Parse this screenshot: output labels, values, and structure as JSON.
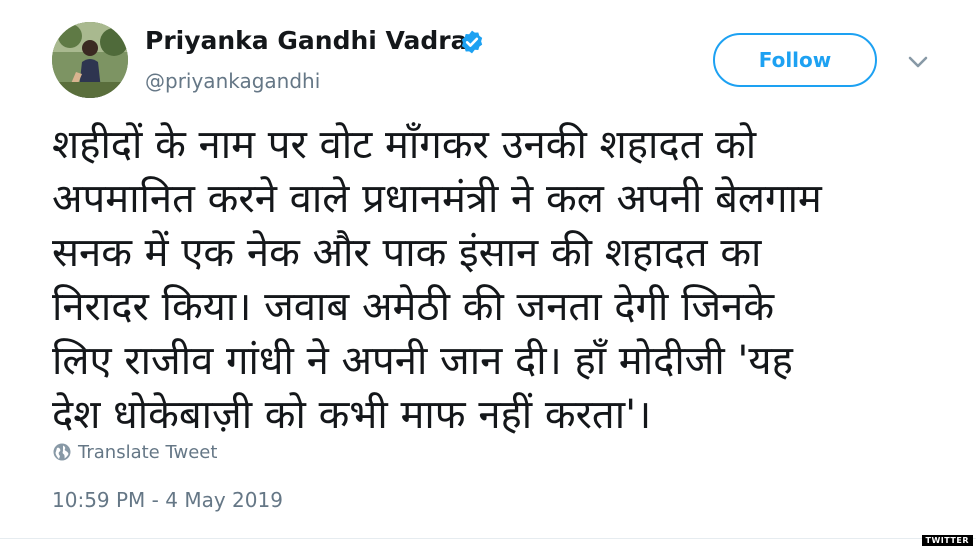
{
  "author": {
    "name": "Priyanka Gandhi Vadra",
    "handle": "@priyankagandhi",
    "verified_icon": "verified-badge-icon"
  },
  "follow": {
    "label": "Follow"
  },
  "menu": {
    "icon": "chevron-down-icon"
  },
  "tweet": {
    "lines": [
      "शहीदों के नाम पर वोट माँगकर उनकी शहादत को",
      "अपमानित करने वाले प्रधानमंत्री ने कल अपनी बेलगाम",
      "सनक में एक नेक और पाक इंसान की शहादत का",
      "निरादर किया। जवाब अमेठी की जनता देगी जिनके",
      "लिए राजीव गांधी ने अपनी जान दी। हाँ मोदीजी 'यह",
      "देश धोकेबाज़ी को कभी माफ नहीं करता'।"
    ]
  },
  "translate": {
    "label": "Translate Tweet",
    "icon": "globe-icon"
  },
  "timestamp": "10:59 PM - 4 May 2019",
  "watermark": "TWITTER",
  "colors": {
    "accent": "#1da1f2",
    "text": "#14171a",
    "muted": "#657786"
  }
}
